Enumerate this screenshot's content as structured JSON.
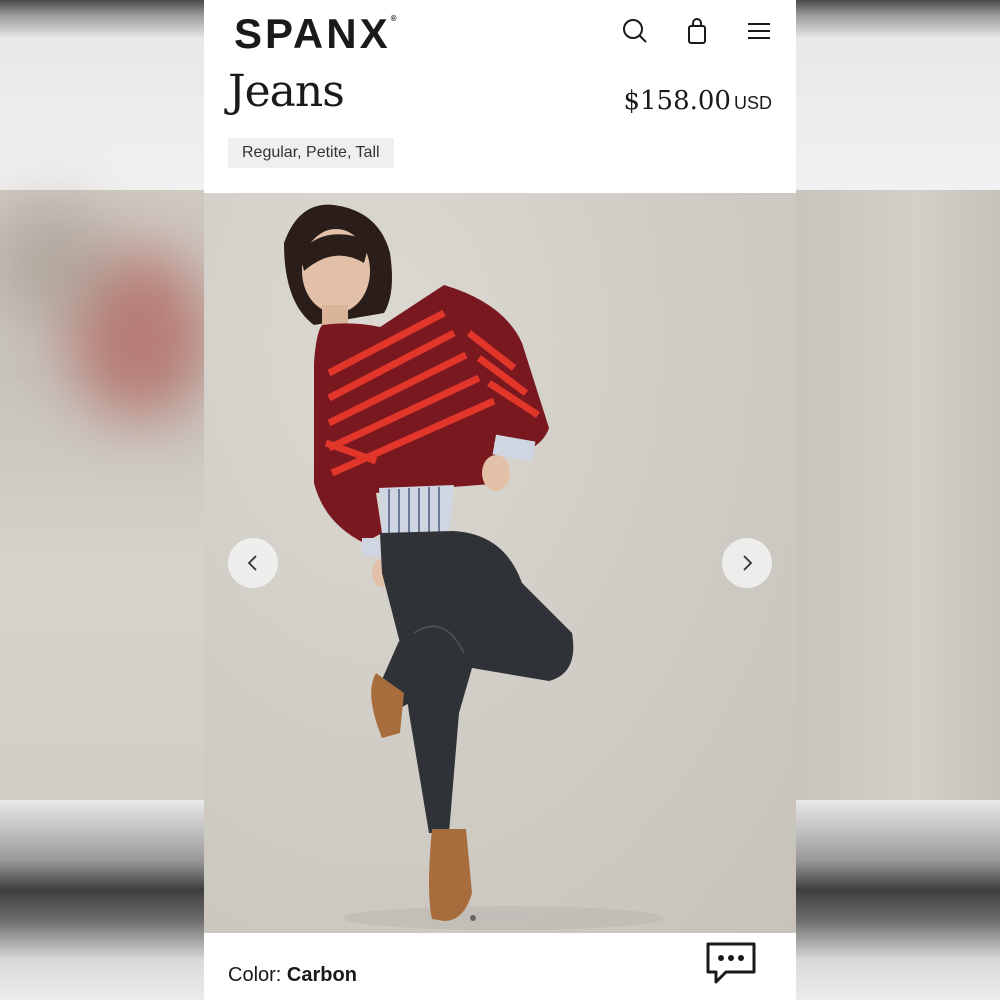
{
  "header": {
    "brand": "SPANX",
    "brand_mark": "®",
    "icons": [
      "search-icon",
      "bag-icon",
      "menu-icon"
    ]
  },
  "product": {
    "title": "Jeans",
    "price": "$158.00",
    "currency": "USD",
    "sizes_label": "Regular, Petite, Tall"
  },
  "gallery": {
    "slide_count": 5,
    "active_index": 0,
    "prev_icon": "chevron-left-icon",
    "next_icon": "chevron-right-icon"
  },
  "color": {
    "label": "Color:",
    "value": "Carbon"
  },
  "chat": {
    "icon": "chat-icon"
  },
  "colors": {
    "text": "#1a1a1a",
    "badge_bg": "#efefef",
    "sweater_base": "#7a1820",
    "sweater_stripe": "#e2362a",
    "jeans": "#2f3236",
    "boots": "#a86d3c"
  }
}
